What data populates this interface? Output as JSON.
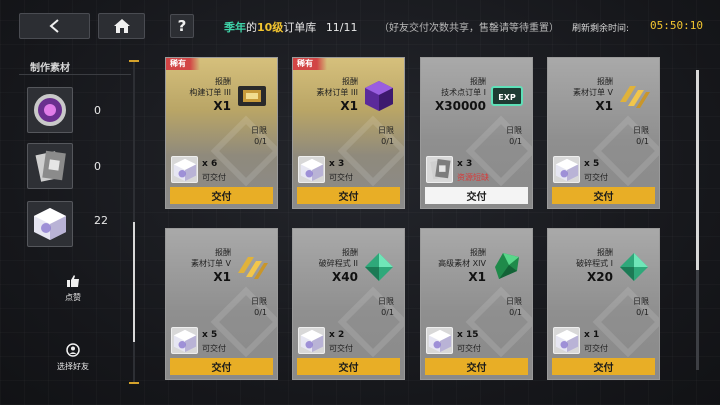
{
  "header": {
    "back_label": "<",
    "help_label": "?",
    "title_season": "季年",
    "title_of": "的",
    "title_level": "10级",
    "title_suffix": "订单库",
    "title_count": "11/11",
    "title_hint": "（好友交付次数共享，售罄请等待重置）",
    "refresh_label": "刷新剩余时间:",
    "refresh_time": "05:50:10"
  },
  "sidebar": {
    "title": "制作素材",
    "materials": [
      {
        "icon": "purple-ring-icon",
        "count": "0"
      },
      {
        "icon": "document-chip-icon",
        "count": "0"
      },
      {
        "icon": "crystal-cube-icon",
        "count": "22"
      }
    ],
    "like_label": "点赞",
    "choose_friend_label": "选择好友"
  },
  "common": {
    "reward_label": "报酬",
    "limit_label": "日限",
    "deliver_label": "交付",
    "rare_label": "稀有"
  },
  "cards": [
    {
      "rare": true,
      "order": "构建订单 III",
      "qty": "X1",
      "reward_icon": "module-chip-icon",
      "limit": "0/1",
      "req_icon": "crystal-cube-icon",
      "req_qty": "x 6",
      "status": "可交付",
      "short": false
    },
    {
      "rare": true,
      "order": "素材订单 III",
      "qty": "X1",
      "reward_icon": "purple-cube-icon",
      "limit": "0/1",
      "req_icon": "crystal-cube-icon",
      "req_qty": "x 3",
      "status": "可交付",
      "short": false
    },
    {
      "rare": false,
      "order": "技术点订单 I",
      "qty": "X30000",
      "reward_icon": "exp-card-icon",
      "limit": "0/1",
      "req_icon": "document-chip-icon",
      "req_qty": "x 3",
      "status": "资源短缺",
      "short": true
    },
    {
      "rare": false,
      "order": "素材订单 V",
      "qty": "X1",
      "reward_icon": "gold-bars-icon",
      "limit": "0/1",
      "req_icon": "crystal-cube-icon",
      "req_qty": "x 5",
      "status": "可交付",
      "short": false
    },
    {
      "rare": false,
      "order": "素材订单 V",
      "qty": "X1",
      "reward_icon": "gold-bars-icon",
      "limit": "0/1",
      "req_icon": "crystal-cube-icon",
      "req_qty": "x 5",
      "status": "可交付",
      "short": false
    },
    {
      "rare": false,
      "order": "破碎程式 II",
      "qty": "X40",
      "reward_icon": "green-shard-icon",
      "limit": "0/1",
      "req_icon": "crystal-cube-icon",
      "req_qty": "x 2",
      "status": "可交付",
      "short": false
    },
    {
      "rare": false,
      "order": "高级素材 XIV",
      "qty": "X1",
      "reward_icon": "green-gem-icon",
      "limit": "0/1",
      "req_icon": "crystal-cube-icon",
      "req_qty": "x 15",
      "status": "可交付",
      "short": false
    },
    {
      "rare": false,
      "order": "破碎程式 I",
      "qty": "X20",
      "reward_icon": "green-shard-icon",
      "limit": "0/1",
      "req_icon": "crystal-cube-icon",
      "req_qty": "x 1",
      "status": "可交付",
      "short": false
    }
  ]
}
